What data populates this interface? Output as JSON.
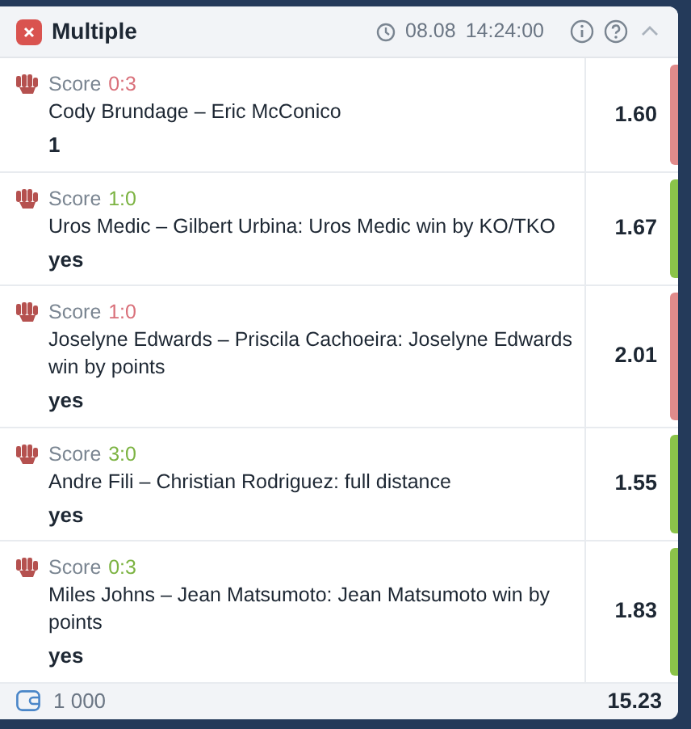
{
  "header": {
    "title": "Multiple",
    "date": "08.08",
    "time": "14:24:00",
    "expanded": true
  },
  "selections": [
    {
      "score_label": "Score",
      "score": "0:3",
      "won": false,
      "event": "Cody Brundage – Eric McConico",
      "pick": "1",
      "odds": "1.60"
    },
    {
      "score_label": "Score",
      "score": "1:0",
      "won": true,
      "event": "Uros Medic – Gilbert Urbina: Uros Medic win by KO/TKO",
      "pick": "yes",
      "odds": "1.67"
    },
    {
      "score_label": "Score",
      "score": "1:0",
      "won": false,
      "event": "Joselyne Edwards – Priscila Cachoeira: Joselyne Edwards win by points",
      "pick": "yes",
      "odds": "2.01"
    },
    {
      "score_label": "Score",
      "score": "3:0",
      "won": true,
      "event": "Andre Fili – Christian Rodriguez: full distance",
      "pick": "yes",
      "odds": "1.55"
    },
    {
      "score_label": "Score",
      "score": "0:3",
      "won": true,
      "event": "Miles Johns – Jean Matsumoto: Jean Matsumoto win by points",
      "pick": "yes",
      "odds": "1.83"
    }
  ],
  "footer": {
    "stake": "1 000",
    "total_odds": "15.23"
  }
}
